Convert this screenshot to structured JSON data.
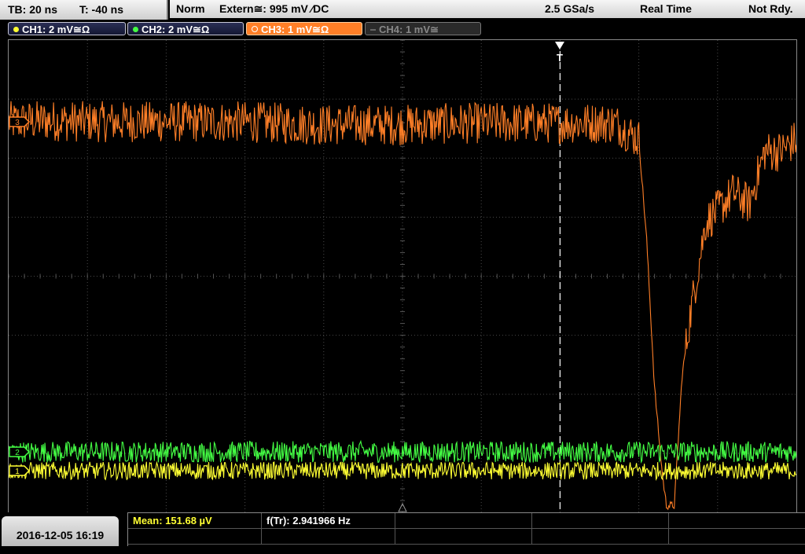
{
  "topbar": {
    "timebase": "TB: 20 ns",
    "trigger_time": "T: -40 ns",
    "trigger_mode": "Norm",
    "trigger_source": "Extern≅: 995 mV ⁄DC",
    "sample_rate": "2.5 GSa/s",
    "acq_mode": "Real Time",
    "status": "Not Rdy."
  },
  "channels": [
    {
      "label": "CH1: 2 mV≅Ω",
      "color": "#ffff33",
      "state": "on"
    },
    {
      "label": "CH2: 2 mV≅Ω",
      "color": "#44ff44",
      "state": "on"
    },
    {
      "label": "CH3: 1 mV≅Ω",
      "color": "#ff7f27",
      "state": "selected"
    },
    {
      "label": "CH4: 1 mV≅",
      "color": "#666666",
      "state": "off"
    }
  ],
  "trigger_marker": "T",
  "ref_markers": {
    "ch3": "3",
    "ch2": "2",
    "ch1": "1"
  },
  "bottombar": {
    "datetime": "2016-12-05 16:19",
    "mean": "Mean: 151.68 µV",
    "freq": "f(Tr): 2.941966 Hz"
  },
  "colors": {
    "ch1": "#ffff33",
    "ch2": "#44ff44",
    "ch3": "#ff7f27",
    "grid": "#4a4a4a"
  },
  "chart_data": {
    "type": "line",
    "grid": {
      "divisions_x": 10,
      "divisions_y": 8
    },
    "series": [
      {
        "key": "ch3",
        "color": "#ff7f27",
        "points": [
          [
            0.0,
            0.0
          ],
          [
            0.5,
            0.02
          ],
          [
            1.0,
            0.0
          ],
          [
            2.0,
            0.0
          ],
          [
            3.0,
            0.0
          ],
          [
            4.0,
            -0.05
          ],
          [
            5.0,
            -0.05
          ],
          [
            6.0,
            -0.02
          ],
          [
            7.0,
            -0.02
          ],
          [
            7.7,
            -0.02
          ],
          [
            8.0,
            -0.3
          ],
          [
            8.1,
            -2.0
          ],
          [
            8.2,
            -4.5
          ],
          [
            8.3,
            -6.0
          ],
          [
            8.35,
            -6.5
          ],
          [
            8.45,
            -6.5
          ],
          [
            8.55,
            -4.3
          ],
          [
            8.65,
            -3.3
          ],
          [
            8.75,
            -2.5
          ],
          [
            8.85,
            -1.7
          ],
          [
            9.0,
            -1.5
          ],
          [
            9.2,
            -1.2
          ],
          [
            9.4,
            -1.4
          ],
          [
            9.6,
            -0.5
          ],
          [
            9.8,
            -0.5
          ],
          [
            10.0,
            -0.3
          ]
        ],
        "noise": 0.35
      },
      {
        "key": "ch2",
        "color": "#44ff44",
        "points": [
          [
            0.0,
            0.0
          ],
          [
            10.0,
            0.0
          ]
        ],
        "noise": 0.18
      },
      {
        "key": "ch1",
        "color": "#ffff33",
        "points": [
          [
            0.0,
            0.0
          ],
          [
            10.0,
            0.0
          ]
        ],
        "noise": 0.15
      }
    ]
  }
}
